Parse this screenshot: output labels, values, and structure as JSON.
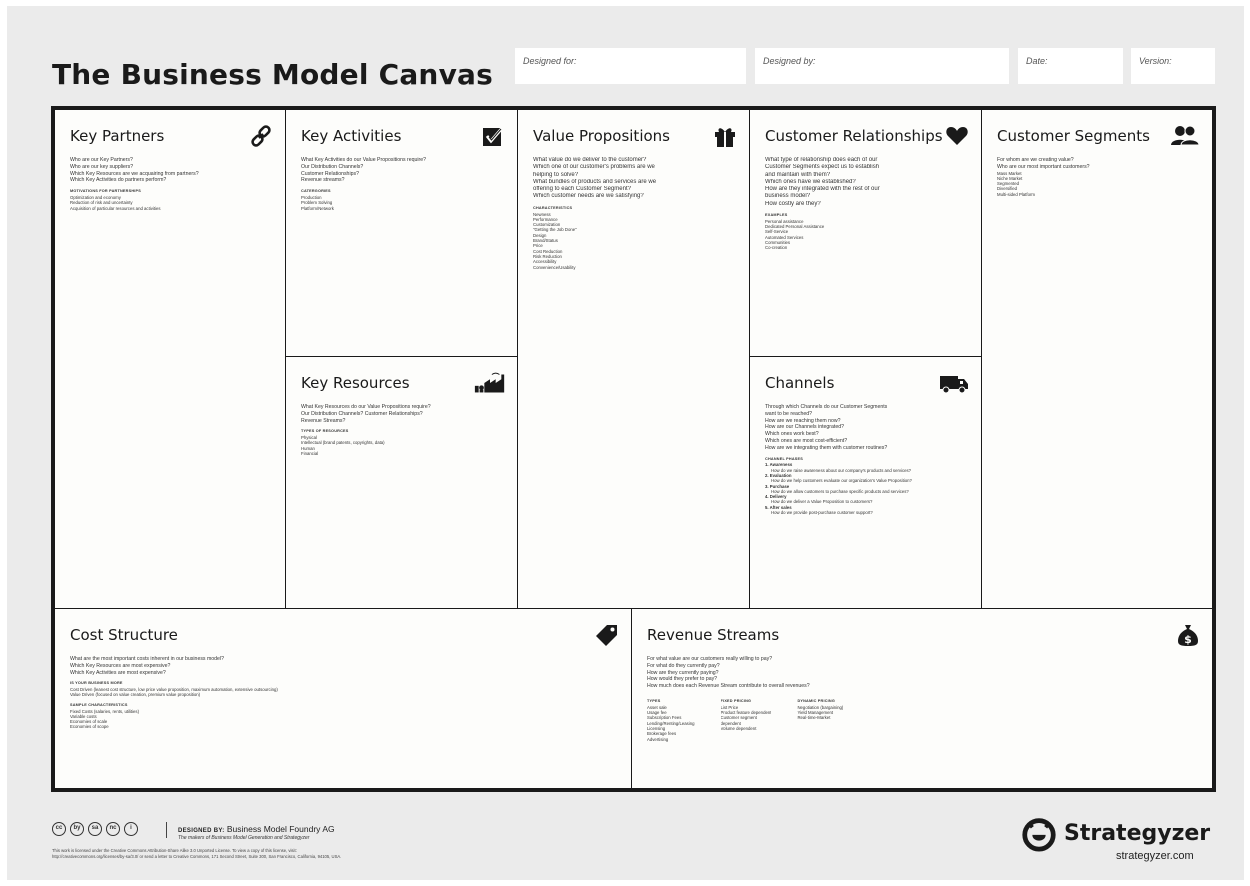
{
  "title": "The Business Model Canvas",
  "header_fields": {
    "designed_for": "Designed for:",
    "designed_by": "Designed by:",
    "date": "Date:",
    "version": "Version:"
  },
  "key_partners": {
    "title": "Key Partners",
    "questions": [
      "Who are our Key Partners?",
      "Who are our key suppliers?",
      "Which Key Resources are we acquairing from partners?",
      "Which Key Activities do partners perform?"
    ],
    "sub_heading": "MOTIVATIONS FOR PARTNERSHIPS",
    "items": [
      "Optimization and economy",
      "Reduction of risk and uncertainty",
      "Acquisition of particular resources and activities"
    ]
  },
  "key_activities": {
    "title": "Key Activities",
    "questions": [
      "What Key Activities do our Value Propositions require?",
      "Our Distribution Channels?",
      "Customer Relationships?",
      "Revenue streams?"
    ],
    "sub_heading": "CATERGORIES",
    "items": [
      "Production",
      "Problem Solving",
      "Platform/Network"
    ]
  },
  "key_resources": {
    "title": "Key Resources",
    "questions": [
      "What Key Resources do our Value Propositions require?",
      "Our Distribution Channels? Customer Relationships?",
      "Revenue Streams?"
    ],
    "sub_heading": "TYPES OF RESOURCES",
    "items": [
      "Physical",
      "Intellectual (brand patents, copyrights, data)",
      "Human",
      "Financial"
    ]
  },
  "value_propositions": {
    "title": "Value Propositions",
    "questions": [
      "What value do we deliver to the customer?",
      "Which one of our customer's problems are we",
      "helping to solve?",
      "What bundles of products and services are we",
      "offering to each Customer Segment?",
      "Which customer needs are we satisfying?"
    ],
    "sub_heading": "CHARACTERISTICS",
    "items": [
      "Newness",
      "Performance",
      "Customization",
      "\"Getting the Job Done\"",
      "Design",
      "Brand/Status",
      "Price",
      "Cost Reduction",
      "Risk Reduction",
      "Accessibility",
      "Convenience/Usability"
    ]
  },
  "customer_relationships": {
    "title": "Customer Relationships",
    "questions": [
      "What type of relationship does each of our",
      "Customer Segments expect us to establish",
      "and maintain with them?",
      "Which ones have we established?",
      "How are they integrated with the rest of our",
      "business model?",
      "How costly are they?"
    ],
    "sub_heading": "EXAMPLES",
    "items": [
      "Personal assistance",
      "Dedicated Personal Assistance",
      "Self-Service",
      "Automated Services",
      "Communities",
      "Co-creation"
    ]
  },
  "channels": {
    "title": "Channels",
    "questions": [
      "Through which Channels do our Customer Segments",
      "want to be reached?",
      "How are we reaching them now?",
      "How are our Channels integrated?",
      "Which ones work best?",
      "Which ones are most cost-efficient?",
      "How are we integrating them with customer routines?"
    ],
    "sub_heading": "CHANNEL PHASES",
    "phases": [
      {
        "label": "1. Awareness",
        "detail": "How do we raise awareness about our company's products and services?"
      },
      {
        "label": "2. Evaluation",
        "detail": "How do we help customers evaluate our organization's Value Proposition?"
      },
      {
        "label": "3. Purchase",
        "detail": "How do we allow customers to purchase specific products and services?"
      },
      {
        "label": "4. Delivery",
        "detail": "How do we deliver a Value Proposition to customers?"
      },
      {
        "label": "5. After sales",
        "detail": "How do we provide post-purchase customer support?"
      }
    ]
  },
  "customer_segments": {
    "title": "Customer Segments",
    "questions": [
      "For whom are we creating value?",
      "Who are our most important customers?"
    ],
    "items": [
      "Mass Market",
      "Niche Market",
      "Segmented",
      "Diversified",
      "Multi-sided Platform"
    ]
  },
  "cost_structure": {
    "title": "Cost Structure",
    "questions": [
      "What are the most important costs inherent in our business model?",
      "Which Key Resources are most expensive?",
      "Which Key Activities are most expensive?"
    ],
    "sub_heading": "IS YOUR BUSINESS MORE",
    "items": [
      "Cost Driven (leanest cost structure, low price value proposition, maximum automation, extensive outsourcing)",
      "Value Driven (focused on value creation, premium value proposition)"
    ],
    "sub_heading_2": "SAMPLE CHARACTERISTICS",
    "items_2": [
      "Fixed Costs (salaries, rents, utilities)",
      "Variable costs",
      "Economies of scale",
      "Economies of scope"
    ]
  },
  "revenue_streams": {
    "title": "Revenue Streams",
    "questions": [
      "For what value are our customers really willing to pay?",
      "For what do they currently pay?",
      "How are they currently paying?",
      "How would they prefer to pay?",
      "How much does each Revenue Stream contribute to overall revenues?"
    ],
    "columns": [
      {
        "heading": "TYPES",
        "items": [
          "Asset sale",
          "Usage fee",
          "Subscription Fees",
          "Lending/Renting/Leasing",
          "Licensing",
          "Brokerage fees",
          "Advertising"
        ]
      },
      {
        "heading": "FIXED PRICING",
        "items": [
          "List Price",
          "Product feature dependent",
          "Customer segment",
          "dependent",
          "Volume dependent"
        ]
      },
      {
        "heading": "DYNAMIC PRICING",
        "items": [
          "Negotiation (bargaining)",
          "Yield Management",
          "Real-time-Market"
        ]
      }
    ]
  },
  "footer": {
    "designed_by_label": "DESIGNED BY:",
    "designed_by_value": "Business Model Foundry AG",
    "makers": "The makers of Business Model Generation and Strategyzer",
    "license_line1": "This work is licensed under the Creative Commons Attribution-Share Alike 3.0 Unported License. To view a copy of this license, visit:",
    "license_line2": "http://creativecommons.org/licenses/by-sa/3.0/ or send a letter to Creative Commons, 171 Second Street, Suite 300, San Francisco, California, 94105, USA.",
    "cc_icons": [
      "cc",
      "by",
      "sa",
      "nc",
      "i"
    ],
    "brand": "Strategyzer",
    "url": "strategyzer.com"
  },
  "colors": {
    "background": "#ebebeb",
    "ink": "#1a1a1a",
    "cell": "#fdfdfb"
  }
}
